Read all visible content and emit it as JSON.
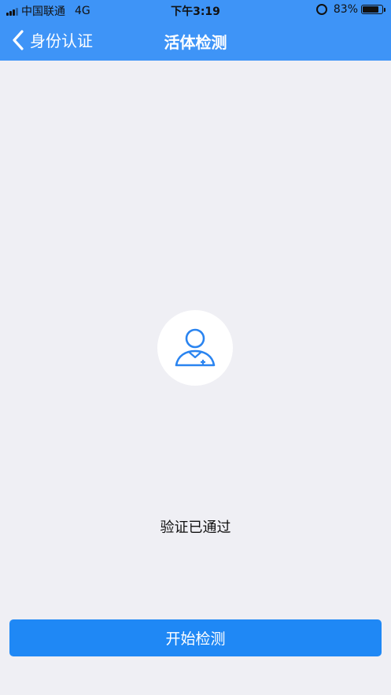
{
  "status_bar": {
    "carrier": "中国联通",
    "network": "4G",
    "time": "下午3:19",
    "battery": "83%",
    "battery_level": 0.83
  },
  "nav": {
    "back_label": "身份认证",
    "title": "活体检测"
  },
  "main": {
    "avatar_icon": "person-icon",
    "status_text": "验证已通过",
    "start_button": "开始检测"
  },
  "colors": {
    "nav_bg": "#3e94f7",
    "page_bg": "#efeff4",
    "button_bg": "#1f88f5",
    "icon_color": "#2a84f0"
  }
}
